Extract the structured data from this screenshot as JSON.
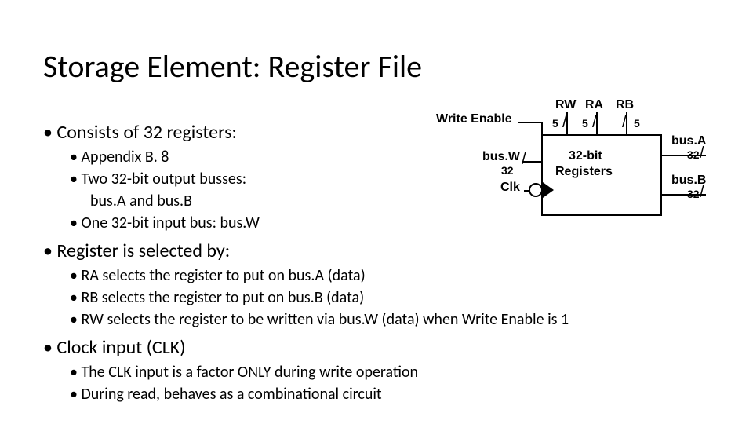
{
  "title": "Storage Element: Register File",
  "bullets": {
    "b1": "Consists of 32 registers:",
    "b1a": "Appendix B. 8",
    "b1b": "Two 32-bit output busses:",
    "b1b2": "bus.A and bus.B",
    "b1c": "One 32-bit input bus: bus.W",
    "b2": "Register is selected by:",
    "b2a": "RA selects the register to put on bus.A (data)",
    "b2b": "RB selects the register to put on bus.B (data)",
    "b2c": "RW selects the register to be  written via bus.W (data) when Write Enable is 1",
    "b3": "Clock input (CLK)",
    "b3a": "The CLK input is a factor ONLY during write operation",
    "b3b": "During read, behaves as a combinational circuit"
  },
  "diagram": {
    "write_enable": "Write Enable",
    "rw": "RW",
    "ra": "RA",
    "rb": "RB",
    "five1": "5",
    "five2": "5",
    "five3": "5",
    "busw": "bus.W",
    "busw_n": "32",
    "clk": "Clk",
    "block1": "32-bit",
    "block2": "Registers",
    "busa": "bus.A",
    "busa_n": "32",
    "busb": "bus.B",
    "busb_n": "32"
  }
}
